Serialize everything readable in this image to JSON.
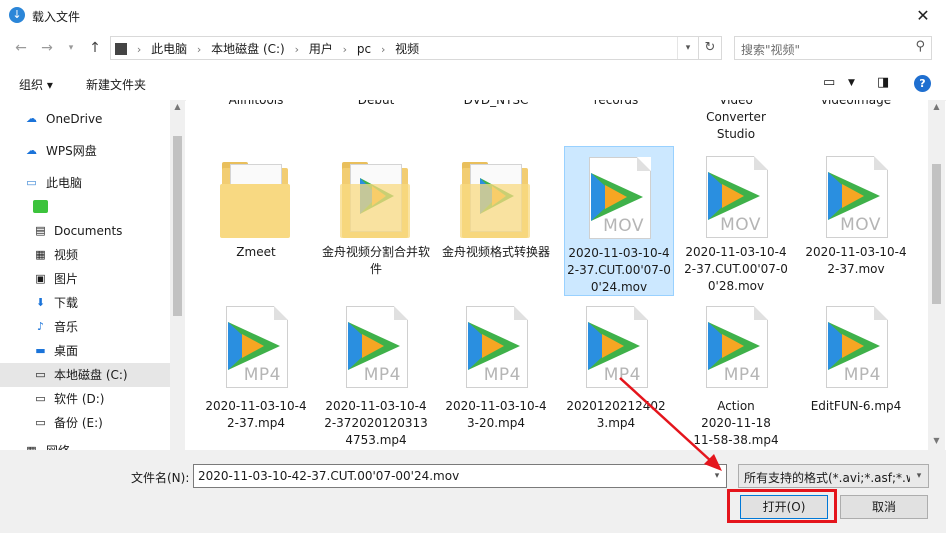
{
  "window": {
    "title": "载入文件",
    "close": "✕"
  },
  "address": {
    "crumbs": [
      "此电脑",
      "本地磁盘 (C:)",
      "用户",
      "pc",
      "视频"
    ]
  },
  "search": {
    "placeholder": "搜索\"视频\""
  },
  "toolbar": {
    "organize": "组织 ▾",
    "new_folder": "新建文件夹"
  },
  "nav": {
    "items": [
      {
        "label": "OneDrive",
        "icon": "cloud-icon"
      },
      {
        "label": "WPS网盘",
        "icon": "cloud-icon"
      },
      {
        "label": "此电脑",
        "icon": "computer-icon"
      },
      {
        "label": "",
        "icon": "app-icon"
      },
      {
        "label": "Documents",
        "icon": "document-icon"
      },
      {
        "label": "视频",
        "icon": "video-icon"
      },
      {
        "label": "图片",
        "icon": "picture-icon"
      },
      {
        "label": "下载",
        "icon": "download-icon"
      },
      {
        "label": "音乐",
        "icon": "music-icon"
      },
      {
        "label": "桌面",
        "icon": "desktop-icon"
      },
      {
        "label": "本地磁盘 (C:)",
        "icon": "drive-icon"
      },
      {
        "label": "软件 (D:)",
        "icon": "drive-icon"
      },
      {
        "label": "备份 (E:)",
        "icon": "drive-icon"
      },
      {
        "label": "网络",
        "icon": "network-icon"
      }
    ]
  },
  "files": {
    "row0": [
      "Allnitools",
      "Debut",
      "DVD_NTSC",
      "records",
      "Video\nConverter\nStudio",
      "videoimage"
    ],
    "row1": [
      {
        "name": "Zmeet",
        "kind": "folder"
      },
      {
        "name": "金舟视频分割合并软件",
        "kind": "folder-app"
      },
      {
        "name": "金舟视频格式转换器",
        "kind": "folder-app"
      },
      {
        "name": "2020-11-03-10-42-37.CUT.00'07-00'24.mov",
        "kind": "video",
        "ext": "MOV",
        "selected": true
      },
      {
        "name": "2020-11-03-10-42-37.CUT.00'07-00'28.mov",
        "kind": "video",
        "ext": "MOV"
      },
      {
        "name": "2020-11-03-10-42-37.mov",
        "kind": "video",
        "ext": "MOV"
      }
    ],
    "row2": [
      {
        "name": "2020-11-03-10-42-37.mp4",
        "ext": "MP4"
      },
      {
        "name": "2020-11-03-10-42-3720201203134753.mp4",
        "ext": "MP4"
      },
      {
        "name": "2020-11-03-10-43-20.mp4",
        "ext": "MP4"
      },
      {
        "name": "20201202124023.mp4",
        "ext": "MP4"
      },
      {
        "name": "Action\n2020-11-18\n11-58-38.mp4",
        "ext": "MP4"
      },
      {
        "name": "EditFUN-6.mp4",
        "ext": "MP4"
      }
    ]
  },
  "footer": {
    "filename_label": "文件名(N):",
    "filename_value": "2020-11-03-10-42-37.CUT.00'07-00'24.mov",
    "filter_value": "所有支持的格式(*.avi;*.asf;*.wr",
    "open_label": "打开(O)",
    "cancel_label": "取消"
  },
  "colors": {
    "accent": "#0078d7",
    "highlight": "#e4151c",
    "selection": "#cce8ff"
  }
}
